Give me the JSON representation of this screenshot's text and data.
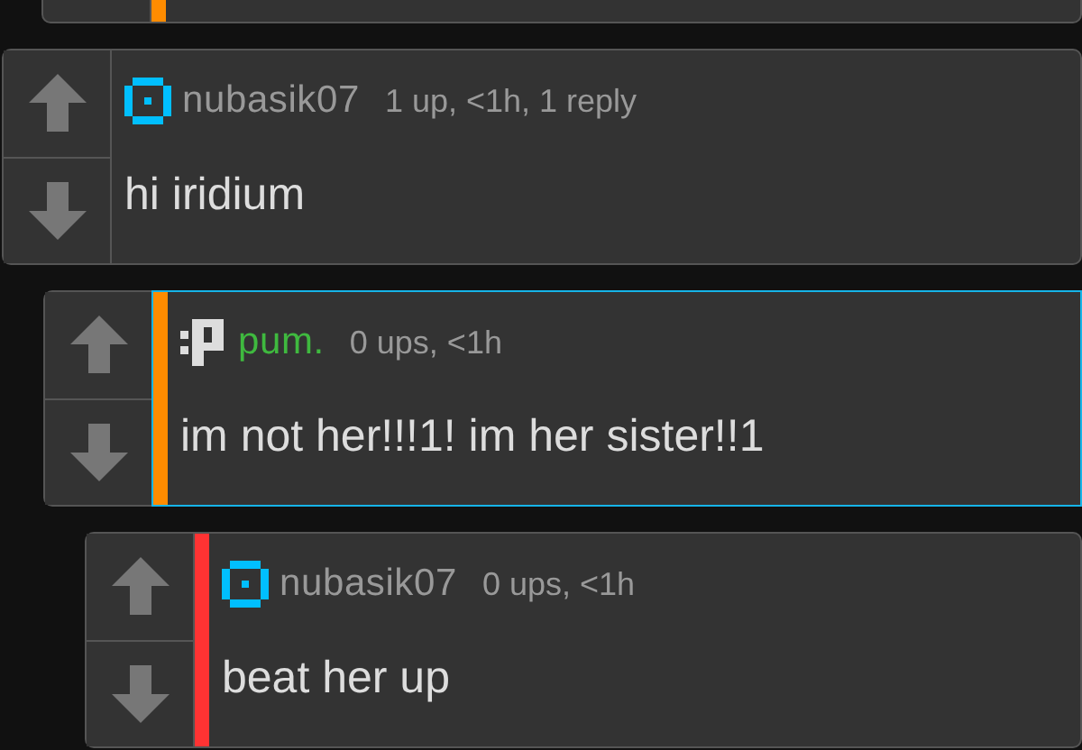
{
  "clipped_reply": {
    "color": "#ff8c00"
  },
  "comments": [
    {
      "avatar": {
        "kind": "square"
      },
      "user": {
        "name": "nubasik07",
        "color": "#999999"
      },
      "meta": "1 up, <1h, 1 reply",
      "text": "hi iridium",
      "highlighted": false,
      "children": [
        {
          "avatar": {
            "kind": "p"
          },
          "user": {
            "name": "pum.",
            "color": "#3fb93f"
          },
          "meta": "0 ups, <1h",
          "text": "im not her!!!1! im her sister!!1",
          "color": "#ff8c00",
          "highlighted": true,
          "children": [
            {
              "avatar": {
                "kind": "square"
              },
              "user": {
                "name": "nubasik07",
                "color": "#999999"
              },
              "meta": "0 ups, <1h",
              "text": "beat her up",
              "color": "#ff3333",
              "highlighted": false
            }
          ]
        }
      ]
    }
  ]
}
